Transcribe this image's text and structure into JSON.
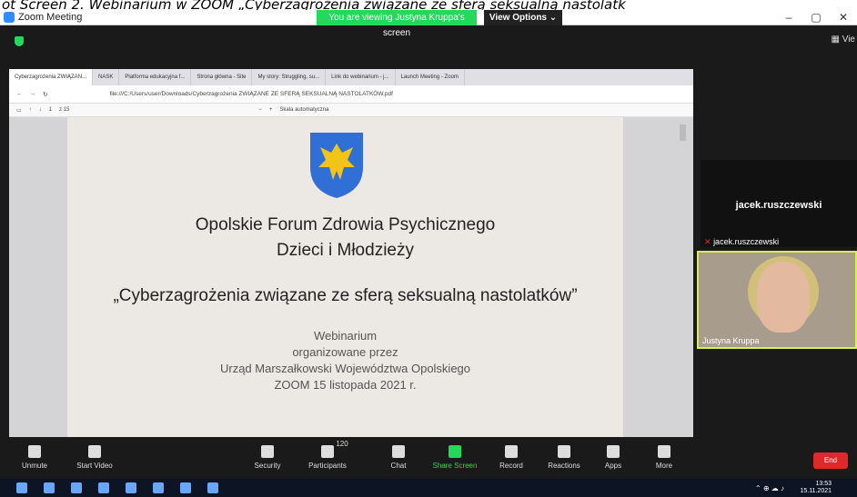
{
  "caption": "ot Screen 2. Webinarium w ZOOM „Cyberzagrożenia związane ze sferą seksualną nastolatk",
  "window": {
    "title": "Zoom Meeting",
    "banner": "You are viewing Justyna Kruppa's screen",
    "view_options": "View Options"
  },
  "browser": {
    "tabs": [
      "Cyberzagrożenia ZWIĄZAN...",
      "NASK",
      "Platforma edukacyjna f...",
      "Strona główna - Site",
      "My story: Struggling, su...",
      "Link do webinarium - j...",
      "Launch Meeting - Zoom"
    ],
    "url": "file:///C:/Users/user/Downloads/Cyberzagrożenia ZWIĄZANE ZE SFERĄ SEKSUALNĄ NASTOLATKÓW.pdf",
    "page": "1",
    "page_total": "z 15",
    "zoom": "Skala automatyczna"
  },
  "pdf": {
    "line1": "Opolskie Forum Zdrowia Psychicznego",
    "line2": "Dzieci i Młodzieży",
    "line3": "„Cyberzagrożenia związane ze sferą seksualną nastolatków”",
    "line4": "Webinarium",
    "line5": "organizowane przez",
    "line6": "Urząd Marszałkowski Województwa Opolskiego",
    "line7": "ZOOM 15 listopada 2021 r."
  },
  "participants": [
    {
      "name": "jacek.ruszczewski",
      "label": "jacek.ruszczewski"
    },
    {
      "name": "Justyna Kruppa",
      "label": "Justyna Kruppa"
    }
  ],
  "toolbar": {
    "unmute": "Unmute",
    "start_video": "Start Video",
    "security": "Security",
    "participants": "Participants",
    "participants_count": "120",
    "chat": "Chat",
    "share_screen": "Share Screen",
    "record": "Record",
    "reactions": "Reactions",
    "apps": "Apps",
    "more": "More",
    "end": "End"
  },
  "taskbar": {
    "time": "13:53",
    "date": "15.11.2021"
  },
  "view_label": "Vie"
}
